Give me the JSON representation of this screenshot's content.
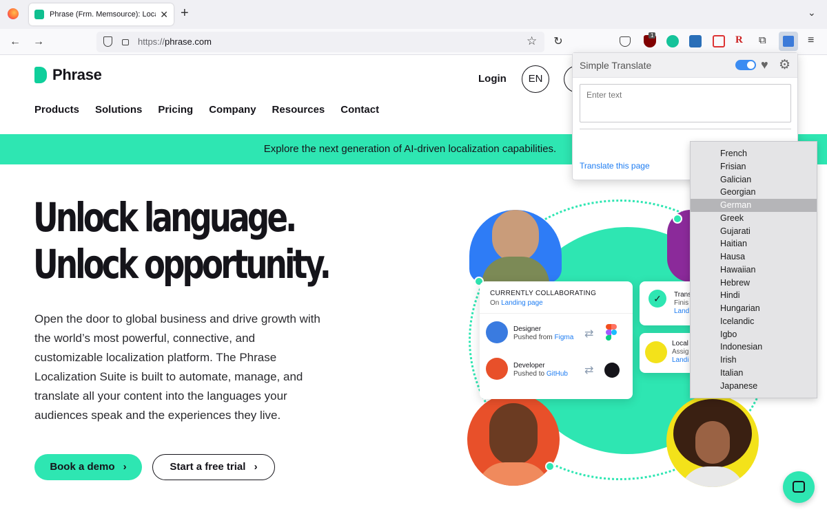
{
  "browser": {
    "tab_title": "Phrase (Frm. Memsource): Loca",
    "new_tab_symbol": "+",
    "url_protocol": "https://",
    "url_domain": "phrase.com",
    "badge_count": "1"
  },
  "site": {
    "logo_text": "Phrase",
    "login": "Login",
    "language": "EN",
    "nav": [
      "Products",
      "Solutions",
      "Pricing",
      "Company",
      "Resources",
      "Contact"
    ],
    "banner": "Explore the next generation of AI-driven localization capabilities.",
    "headline_1": "Unlock language.",
    "headline_2": "Unlock opportunity.",
    "paragraph": "Open the door to global business and drive growth with the world’s most powerful, connective, and customizable localization platform. The Phrase Localization Suite is built to automate, manage, and translate all your content into the languages your audiences speak and the experiences they live.",
    "cta_demo": "Book a demo",
    "cta_trial": "Start a free trial",
    "collab": {
      "title": "CURRENTLY COLLABORATING",
      "on_prefix": "On",
      "on_link": "Landing page",
      "rows": [
        {
          "role": "Designer",
          "action": "Pushed from",
          "source": "Figma"
        },
        {
          "role": "Developer",
          "action": "Pushed to",
          "source": "GitHub"
        }
      ]
    },
    "card2": {
      "line1": "Trans",
      "line2": "Finis",
      "line3": "Land"
    },
    "card3": {
      "line1": "Local",
      "line2": "Assig",
      "line3": "Landi"
    }
  },
  "extension": {
    "title": "Simple Translate",
    "textarea_placeholder": "Enter text",
    "translate_link": "Translate this page",
    "languages": [
      "French",
      "Frisian",
      "Galician",
      "Georgian",
      "German",
      "Greek",
      "Gujarati",
      "Haitian",
      "Hausa",
      "Hawaiian",
      "Hebrew",
      "Hindi",
      "Hungarian",
      "Icelandic",
      "Igbo",
      "Indonesian",
      "Irish",
      "Italian",
      "Japanese"
    ],
    "selected_language": "German"
  },
  "colors": {
    "brand_mint": "#2ee6b2",
    "link_blue": "#1d7cf2",
    "text_dark": "#15141a"
  }
}
